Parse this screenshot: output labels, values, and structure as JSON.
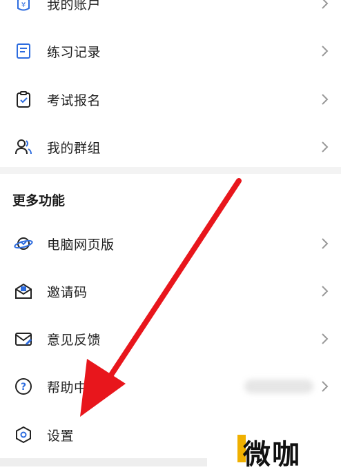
{
  "menu_top": [
    {
      "label": "我的账户",
      "icon": "wallet-yen-icon"
    },
    {
      "label": "练习记录",
      "icon": "notebook-icon"
    },
    {
      "label": "考试报名",
      "icon": "clipboard-check-icon"
    },
    {
      "label": "我的群组",
      "icon": "group-users-icon"
    }
  ],
  "more_section": {
    "title": "更多功能",
    "items": [
      {
        "label": "电脑网页版",
        "icon": "planet-icon"
      },
      {
        "label": "邀请码",
        "icon": "invite-envelope-icon"
      },
      {
        "label": "意见反馈",
        "icon": "feedback-mail-icon"
      },
      {
        "label": "帮助中",
        "icon": "help-circle-icon"
      },
      {
        "label": "设置",
        "icon": "settings-hexagon-icon"
      }
    ]
  },
  "watermark": {
    "text": "微咖"
  },
  "colors": {
    "accent": "#2d6cdf",
    "arrow": "#e8161c",
    "divider": "#f3f3f3",
    "watermark_yellow": "#f0b000"
  }
}
